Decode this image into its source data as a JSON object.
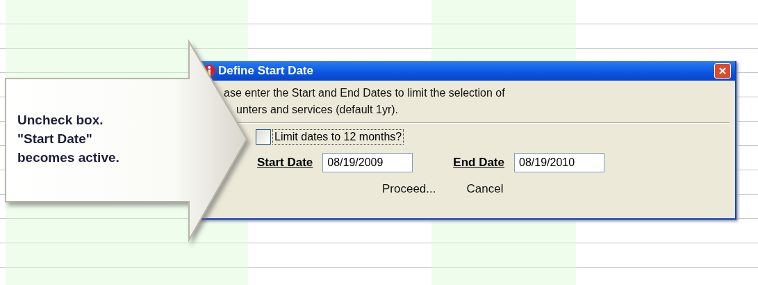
{
  "callout": {
    "lines": [
      "Uncheck box.",
      "\"Start Date\"",
      "becomes active."
    ]
  },
  "dialog": {
    "title": "Define Start Date",
    "message_lines": [
      "ase enter the Start and End Dates to limit the selection of",
      "unters and services (default 1yr)."
    ],
    "checkbox": {
      "label": "Limit dates to 12 months?",
      "checked": false
    },
    "fields": [
      {
        "label": "Start Date",
        "value": "08/19/2009"
      },
      {
        "label": "End Date",
        "value": "08/19/2010"
      }
    ],
    "buttons": [
      "Proceed...",
      "Cancel"
    ]
  }
}
